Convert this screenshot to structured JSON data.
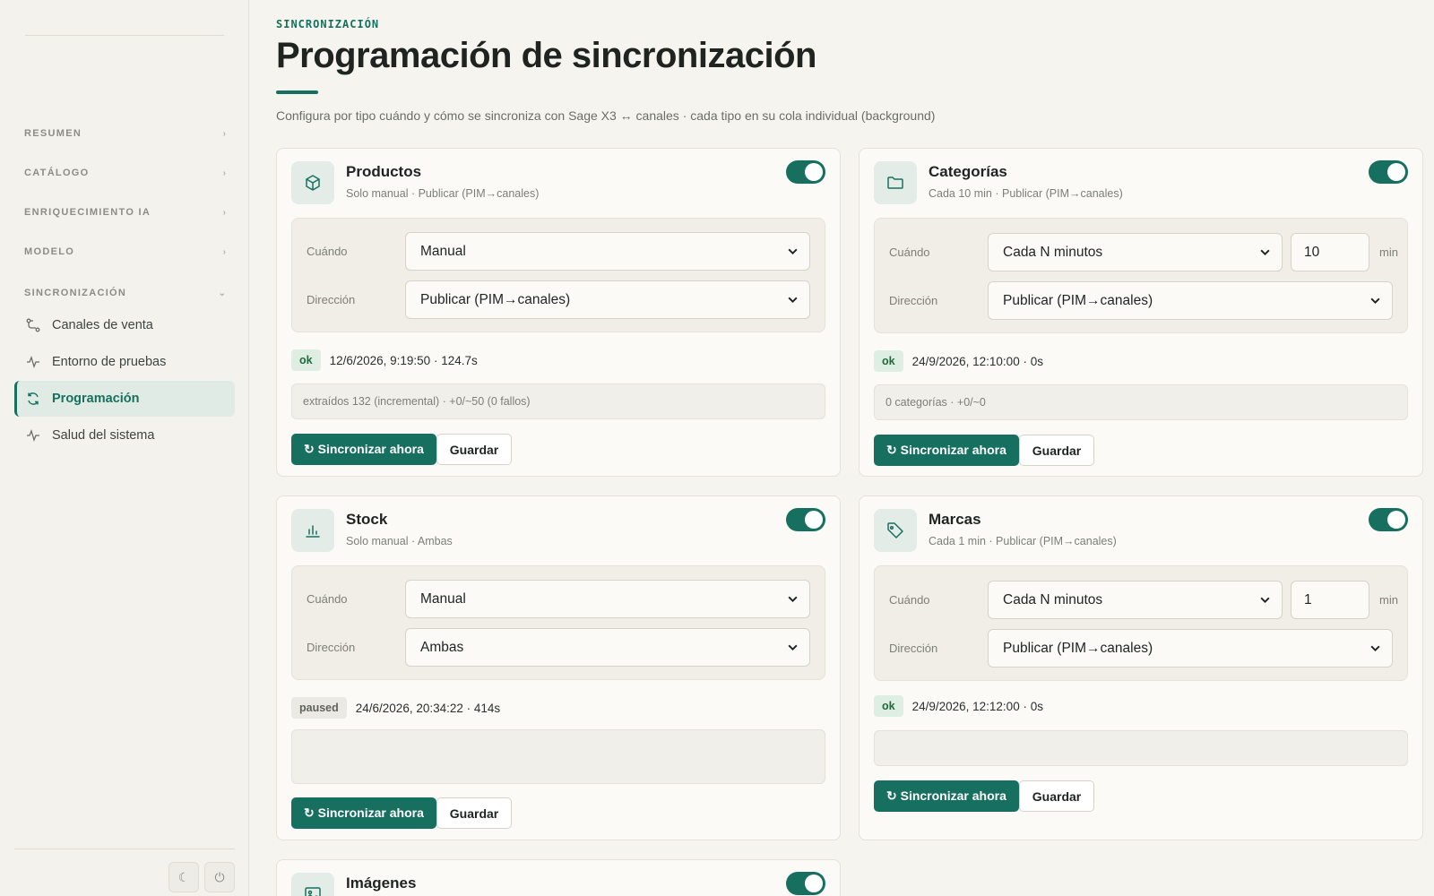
{
  "sidebar": {
    "sections": [
      {
        "label": "RESUMEN"
      },
      {
        "label": "CATÁLOGO"
      },
      {
        "label": "ENRIQUECIMIENTO IA"
      },
      {
        "label": "MODELO"
      },
      {
        "label": "SINCRONIZACIÓN"
      }
    ],
    "items": [
      {
        "label": "Canales de venta",
        "icon": "channels-icon"
      },
      {
        "label": "Entorno de pruebas",
        "icon": "activity-icon"
      },
      {
        "label": "Programación",
        "icon": "refresh-icon",
        "active": true
      },
      {
        "label": "Salud del sistema",
        "icon": "activity-icon"
      }
    ],
    "footer": {
      "theme_icon": "☾",
      "power_icon": "⏻"
    }
  },
  "header": {
    "eyebrow": "SINCRONIZACIÓN",
    "title": "Programación de sincronización",
    "subtitle": "Configura por tipo cuándo y cómo se sincroniza con Sage X3 ↔ canales · cada tipo en su cola individual (background)"
  },
  "labels": {
    "when": "Cuándo",
    "direction": "Dirección",
    "sync_now": "↻ Sincronizar ahora",
    "save": "Guardar",
    "unit_min": "min"
  },
  "cards": {
    "productos": {
      "title": "Productos",
      "subtitle": "Solo manual · Publicar (PIM→canales)",
      "enabled": true,
      "when": "Manual",
      "direction": "Publicar (PIM→canales)",
      "status": "ok",
      "status_text": "12/6/2026, 9:19:50 · 124.7s",
      "note": "extraídos 132 (incremental) · +0/~50 (0 fallos)"
    },
    "categorias": {
      "title": "Categorías",
      "subtitle": "Cada 10 min · Publicar (PIM→canales)",
      "enabled": true,
      "when": "Cada N minutos",
      "minutes": "10",
      "direction": "Publicar (PIM→canales)",
      "status": "ok",
      "status_text": "24/9/2026, 12:10:00 · 0s",
      "note": "0 categorías · +0/~0"
    },
    "stock": {
      "title": "Stock",
      "subtitle": "Solo manual · Ambas",
      "enabled": true,
      "when": "Manual",
      "direction": "Ambas",
      "status": "paused",
      "status_text": "24/6/2026, 20:34:22 · 414s",
      "note": ""
    },
    "marcas": {
      "title": "Marcas",
      "subtitle": "Cada 1 min · Publicar (PIM→canales)",
      "enabled": true,
      "when": "Cada N minutos",
      "minutes": "1",
      "direction": "Publicar (PIM→canales)",
      "status": "ok",
      "status_text": "24/9/2026, 12:12:00 · 0s",
      "note": ""
    },
    "imagenes": {
      "title": "Imágenes",
      "enabled": true
    }
  },
  "colors": {
    "accent": "#17705f",
    "background": "#f6f4ee",
    "card": "#fbfaf6",
    "ok_badge": "#dfeee3",
    "paused_badge": "#ebe9e3"
  }
}
